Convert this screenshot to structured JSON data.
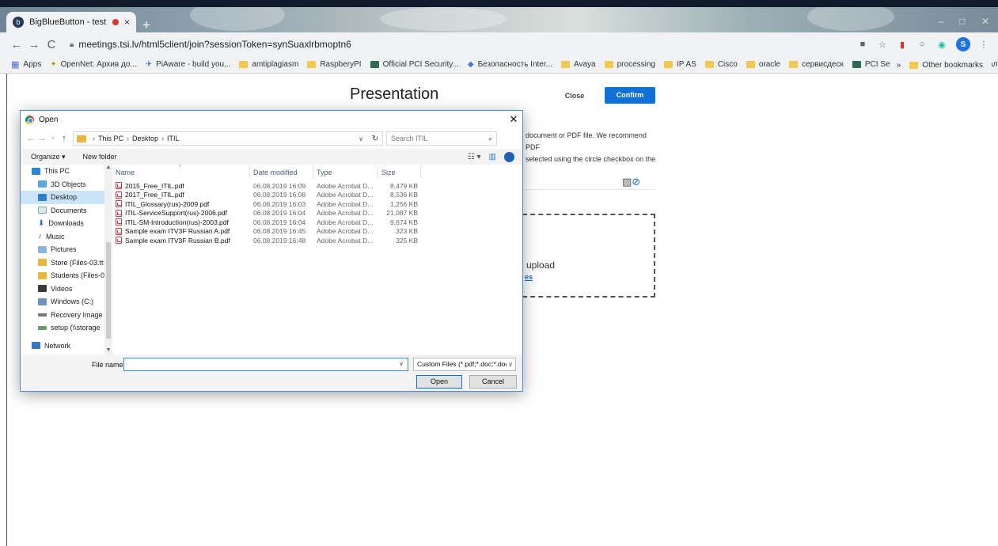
{
  "browser": {
    "tab_title": "BigBlueButton - test",
    "tab_close": "×",
    "new_tab": "+",
    "url": "meetings.tsi.lv/html5client/join?sessionToken=synSuaxlrbmoptn6",
    "back": "←",
    "forward": "→",
    "reload": "C",
    "profile_initial": "S",
    "bookmarks": [
      {
        "label": "Apps",
        "icon": "apps-grid-icon"
      },
      {
        "label": "OpenNet: Архив до...",
        "icon": "star-bookmark-icon"
      },
      {
        "label": "PiAware - build you...",
        "icon": "plane-icon"
      },
      {
        "label": "amtiplagiasm",
        "icon": "folder-icon"
      },
      {
        "label": "RaspberyPI",
        "icon": "folder-icon"
      },
      {
        "label": "Official PCI Security...",
        "icon": "pci-icon"
      },
      {
        "label": "Безопасность Inter...",
        "icon": "diamond-icon"
      },
      {
        "label": "Avaya",
        "icon": "folder-icon"
      },
      {
        "label": "processing",
        "icon": "folder-icon"
      },
      {
        "label": "IP AS",
        "icon": "folder-icon"
      },
      {
        "label": "Cisco",
        "icon": "folder-icon"
      },
      {
        "label": "oracle",
        "icon": "folder-icon"
      },
      {
        "label": "сервисдеск",
        "icon": "folder-icon"
      },
      {
        "label": "PCI Security Standa...",
        "icon": "pci-icon"
      },
      {
        "label": "VID - Налоги",
        "icon": "vid-icon"
      }
    ],
    "more_bookmarks": "»",
    "other_bookmarks": "Other bookmarks"
  },
  "presentation": {
    "title": "Presentation",
    "close_label": "Close",
    "confirm_label": "Confirm",
    "instructions_line1": "document or PDF file. We recommend PDF",
    "instructions_line2": "selected using the circle checkbox on the",
    "drop_text": "upload",
    "drop_link": "es"
  },
  "dialog": {
    "title": "Open",
    "breadcrumb": [
      "This PC",
      "Desktop",
      "ITIL"
    ],
    "search_placeholder": "Search ITIL",
    "organize_label": "Organize ▾",
    "new_folder_label": "New folder",
    "nav_items": [
      {
        "label": "This PC",
        "icon": "this-pc-icon",
        "cls": "pc",
        "sub": false,
        "selected": false
      },
      {
        "label": "3D Objects",
        "icon": "3d-objects-icon",
        "cls": "obj",
        "sub": true,
        "selected": false
      },
      {
        "label": "Desktop",
        "icon": "desktop-icon",
        "cls": "desk",
        "sub": true,
        "selected": true
      },
      {
        "label": "Documents",
        "icon": "documents-icon",
        "cls": "docs",
        "sub": true,
        "selected": false
      },
      {
        "label": "Downloads",
        "icon": "downloads-icon",
        "cls": "down",
        "sub": true,
        "selected": false
      },
      {
        "label": "Music",
        "icon": "music-icon",
        "cls": "music",
        "sub": true,
        "selected": false
      },
      {
        "label": "Pictures",
        "icon": "pictures-icon",
        "cls": "pics",
        "sub": true,
        "selected": false
      },
      {
        "label": "Store (Files-03.tt",
        "icon": "network-drive-icon",
        "cls": "store",
        "sub": true,
        "selected": false
      },
      {
        "label": "Students (Files-0",
        "icon": "network-drive-icon",
        "cls": "store",
        "sub": true,
        "selected": false
      },
      {
        "label": "Videos",
        "icon": "videos-icon",
        "cls": "vid",
        "sub": true,
        "selected": false
      },
      {
        "label": "Windows (C:)",
        "icon": "drive-icon",
        "cls": "win",
        "sub": true,
        "selected": false
      },
      {
        "label": "Recovery Image",
        "icon": "drive-icon",
        "cls": "rec",
        "sub": true,
        "selected": false
      },
      {
        "label": "setup (\\\\storage",
        "icon": "network-drive-icon",
        "cls": "setup",
        "sub": true,
        "selected": false
      }
    ],
    "network_label": "Network",
    "columns": {
      "name": "Name",
      "date": "Date modified",
      "type": "Type",
      "size": "Size"
    },
    "files": [
      {
        "name": "2015_Free_ITIL.pdf",
        "date": "06.08.2019 16:09",
        "type": "Adobe Acrobat D...",
        "size": "8,479 KB"
      },
      {
        "name": "2017_Free_ITIL.pdf",
        "date": "06.08.2019 16:08",
        "type": "Adobe Acrobat D...",
        "size": "8,536 KB"
      },
      {
        "name": "ITIL_Glossary(rus)-2009.pdf",
        "date": "06.08.2019 16:03",
        "type": "Adobe Acrobat D...",
        "size": "1,256 KB"
      },
      {
        "name": "ITIL-ServiceSupport(rus)-2006.pdf",
        "date": "06.08.2019 16:04",
        "type": "Adobe Acrobat D...",
        "size": "21,087 KB"
      },
      {
        "name": "ITIL-SM-Introduction(rus)-2003.pdf",
        "date": "06.08.2019 16:04",
        "type": "Adobe Acrobat D...",
        "size": "9,674 KB"
      },
      {
        "name": "Sample exam ITV3F Russian A.pdf",
        "date": "06.08.2019 16:45",
        "type": "Adobe Acrobat D...",
        "size": "323 KB"
      },
      {
        "name": "Sample exam ITV3F Russian B.pdf",
        "date": "06.08.2019 16:48",
        "type": "Adobe Acrobat D...",
        "size": "325 KB"
      }
    ],
    "filename_label": "File name:",
    "filename_value": "",
    "filter_label": "Custom Files (*.pdf;*.doc;*.doc",
    "open_label": "Open",
    "cancel_label": "Cancel"
  },
  "colors": {
    "accent": "#0f70d7",
    "selection": "#cce4f7",
    "dialog_border": "#4f8ad6"
  }
}
